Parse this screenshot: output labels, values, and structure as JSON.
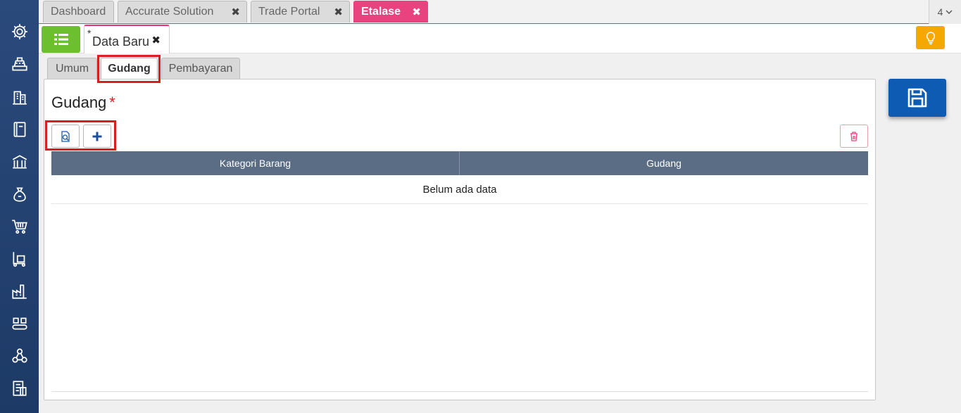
{
  "sidebar": {
    "icons": [
      "gear-icon",
      "cash-register-icon",
      "building-icon",
      "book-icon",
      "bank-icon",
      "money-bag-icon",
      "shopping-cart-icon",
      "hand-truck-icon",
      "factory-icon",
      "conveyor-icon",
      "network-icon",
      "tax-document-icon"
    ]
  },
  "top_tabs": {
    "dashboard": "Dashboard",
    "accurate": "Accurate Solution",
    "trade": "Trade Portal",
    "etalase": "Etalase",
    "close": "✖",
    "count": "4"
  },
  "doc_tab": {
    "star": "*",
    "label": "Data Baru",
    "close": "✖"
  },
  "inner_tabs": {
    "umum": "Umum",
    "gudang": "Gudang",
    "pembayaran": "Pembayaran"
  },
  "panel": {
    "title": "Gudang",
    "required": "*"
  },
  "grid": {
    "columns": [
      "Kategori Barang",
      "Gudang"
    ],
    "empty_text": "Belum ada data"
  },
  "colors": {
    "accent": "#e8427f",
    "sidebar": "#2b4a7c",
    "save": "#0d5bb3",
    "menu": "#6cbf2e",
    "bulb": "#f7a800",
    "header": "#5a6d84"
  }
}
